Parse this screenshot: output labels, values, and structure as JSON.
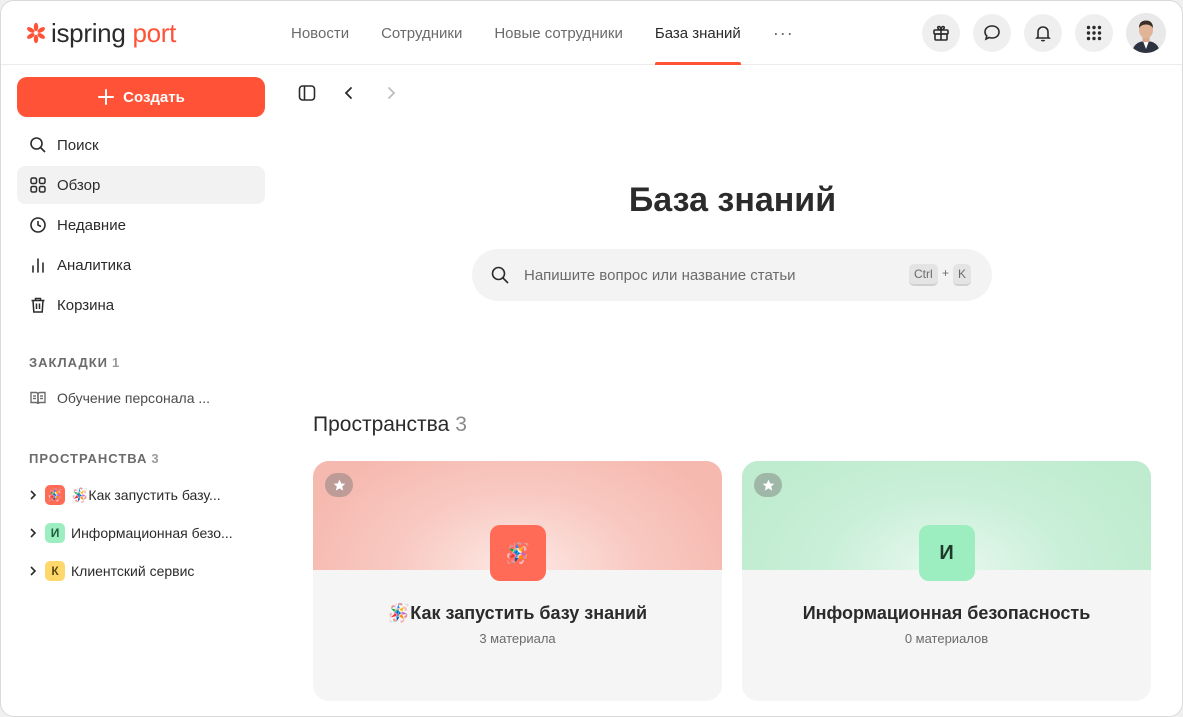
{
  "brand": {
    "word1": "ispring",
    "word2": "port"
  },
  "nav": {
    "items": [
      {
        "label": "Новости"
      },
      {
        "label": "Сотрудники"
      },
      {
        "label": "Новые сотрудники"
      },
      {
        "label": "База знаний",
        "active": true
      }
    ],
    "more": "···"
  },
  "header_icons": [
    "gift-icon",
    "chat-icon",
    "bell-icon",
    "apps-grid-icon",
    "user-avatar"
  ],
  "sidebar": {
    "create_label": "Создать",
    "menu": [
      {
        "label": "Поиск",
        "icon": "search-icon"
      },
      {
        "label": "Обзор",
        "icon": "grid-icon",
        "active": true
      },
      {
        "label": "Недавние",
        "icon": "clock-icon"
      },
      {
        "label": "Аналитика",
        "icon": "analytics-icon"
      },
      {
        "label": "Корзина",
        "icon": "trash-icon"
      }
    ],
    "bookmarks": {
      "title": "ЗАКЛАДКИ",
      "count": "1",
      "items": [
        {
          "label": "Обучение персонала ..."
        }
      ]
    },
    "spaces": {
      "title": "ПРОСТРАНСТВА",
      "count": "3",
      "items": [
        {
          "label": "🪅Как запустить базу...",
          "badge": "🪅",
          "badge_color": "#ff6b57"
        },
        {
          "label": "Информационная безо...",
          "badge": "И",
          "badge_color": "#9ceec0"
        },
        {
          "label": "Клиентский сервис",
          "badge": "К",
          "badge_color": "#ffd86b"
        }
      ]
    }
  },
  "main": {
    "title": "База знаний",
    "search": {
      "placeholder": "Напишите вопрос или название статьи",
      "key1": "Ctrl",
      "plus": "+",
      "key2": "K"
    },
    "spaces_heading": "Пространства",
    "spaces_count": "3",
    "cards": [
      {
        "title": "🪅Как запустить базу знаний",
        "subtitle": "3 материала",
        "icon": "🪅",
        "color": "#ff6b57"
      },
      {
        "title": "Информационная безопасность",
        "subtitle": "0 материалов",
        "icon": "И",
        "color": "#9ceec0"
      }
    ]
  },
  "colors": {
    "accent": "#ff5236",
    "sidebar_active": "#f2f2f2",
    "card_bg": "#f5f5f5"
  }
}
